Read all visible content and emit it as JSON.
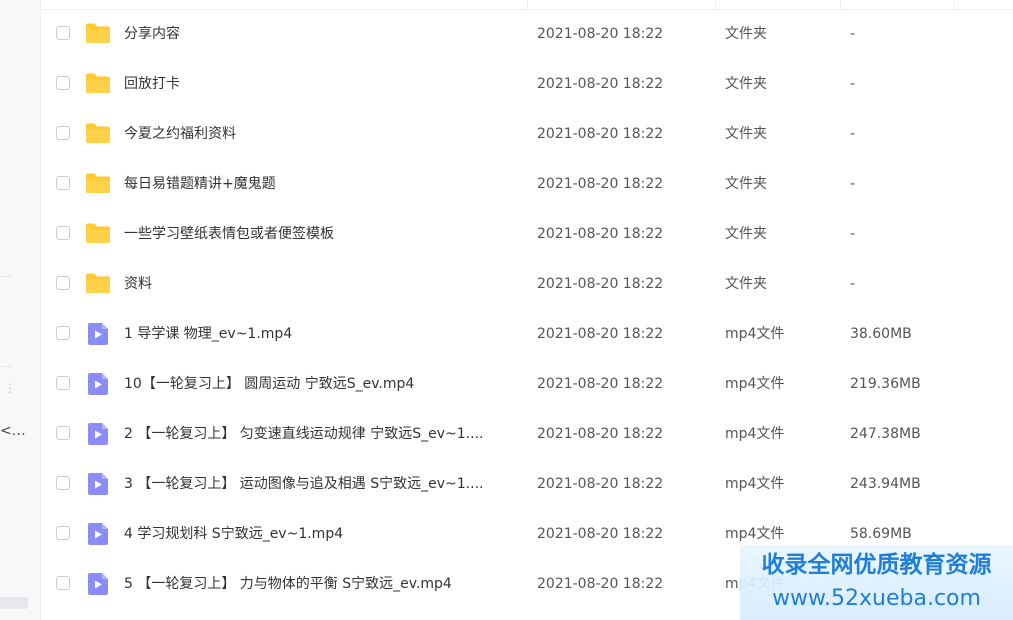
{
  "sidebar": {
    "truncated_label": "<…"
  },
  "files": [
    {
      "kind": "folder",
      "name": "分享内容",
      "date": "2021-08-20 18:22",
      "type": "文件夹",
      "size": "-"
    },
    {
      "kind": "folder",
      "name": "回放打卡",
      "date": "2021-08-20 18:22",
      "type": "文件夹",
      "size": "-"
    },
    {
      "kind": "folder",
      "name": "今夏之约福利资料",
      "date": "2021-08-20 18:22",
      "type": "文件夹",
      "size": "-"
    },
    {
      "kind": "folder",
      "name": "每日易错题精讲+魔鬼题",
      "date": "2021-08-20 18:22",
      "type": "文件夹",
      "size": "-"
    },
    {
      "kind": "folder",
      "name": "一些学习壁纸表情包或者便签模板",
      "date": "2021-08-20 18:22",
      "type": "文件夹",
      "size": "-"
    },
    {
      "kind": "folder",
      "name": "资料",
      "date": "2021-08-20 18:22",
      "type": "文件夹",
      "size": "-"
    },
    {
      "kind": "video",
      "name": "1 导学课 物理_ev~1.mp4",
      "date": "2021-08-20 18:22",
      "type": "mp4文件",
      "size": "38.60MB"
    },
    {
      "kind": "video",
      "name": "10【一轮复习上】 圆周运动 宁致远S_ev.mp4",
      "date": "2021-08-20 18:22",
      "type": "mp4文件",
      "size": "219.36MB"
    },
    {
      "kind": "video",
      "name": "2 【一轮复习上】 匀变速直线运动规律 宁致远S_ev~1....",
      "date": "2021-08-20 18:22",
      "type": "mp4文件",
      "size": "247.38MB"
    },
    {
      "kind": "video",
      "name": "3 【一轮复习上】 运动图像与追及相遇 S宁致远_ev~1....",
      "date": "2021-08-20 18:22",
      "type": "mp4文件",
      "size": "243.94MB"
    },
    {
      "kind": "video",
      "name": "4 学习规划科 S宁致远_ev~1.mp4",
      "date": "2021-08-20 18:22",
      "type": "mp4文件",
      "size": "58.69MB"
    },
    {
      "kind": "video",
      "name": "5 【一轮复习上】 力与物体的平衡 S宁致远_ev.mp4",
      "date": "2021-08-20 18:22",
      "type": "mp4文件",
      "size": ""
    }
  ],
  "watermark": {
    "line1": "收录全网优质教育资源",
    "line2": "www.52xueba.com"
  },
  "colors": {
    "folder": "#ffc933",
    "video": "#8c8cf8",
    "watermark_text": "#1f7fd8"
  }
}
